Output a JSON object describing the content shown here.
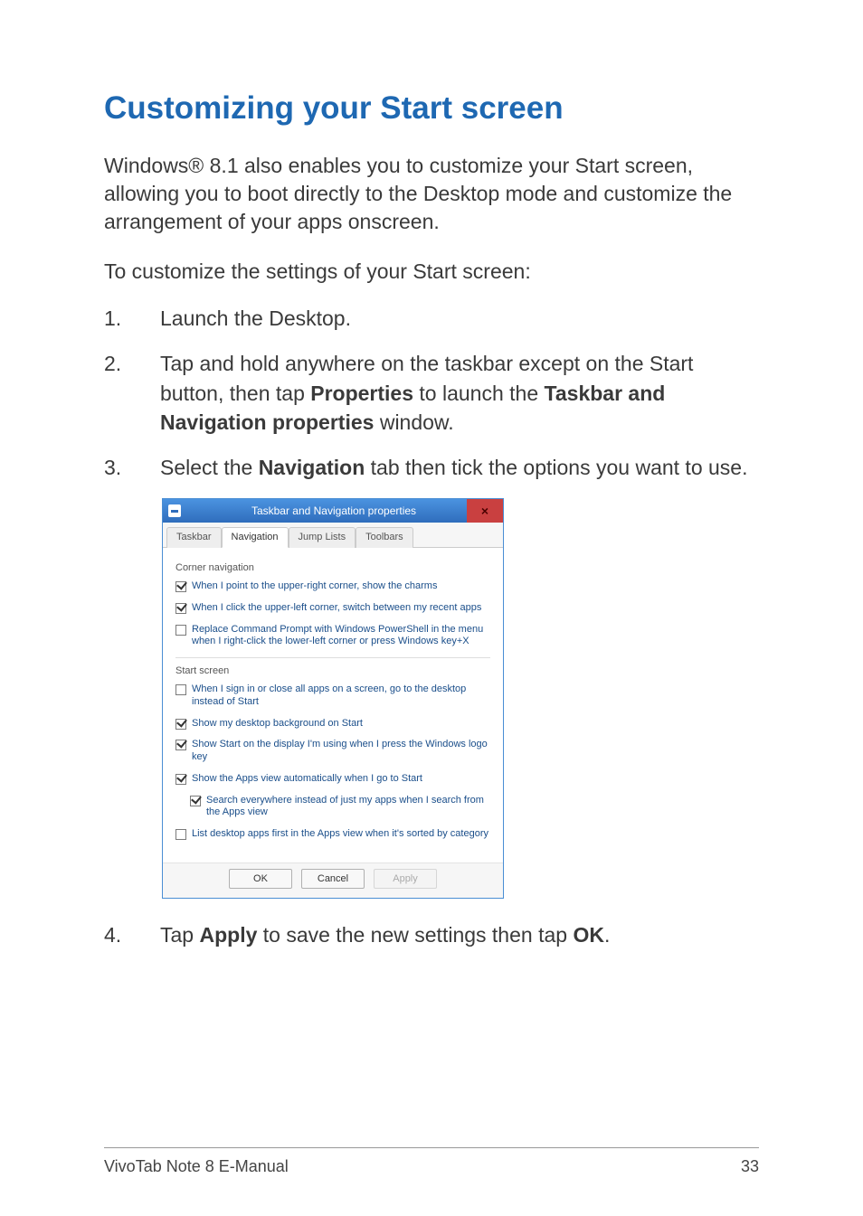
{
  "heading": "Customizing your Start screen",
  "intro": "Windows® 8.1 also enables you to customize your Start screen, allowing you to boot directly to the Desktop mode and customize the arrangement of your apps onscreen.",
  "instruction": "To customize the settings of your Start screen:",
  "steps": {
    "s1": {
      "num": "1.",
      "text": "Launch the Desktop."
    },
    "s2": {
      "num": "2.",
      "pre": "Tap and hold anywhere on the taskbar except on the Start button, then tap ",
      "b1": "Properties",
      "mid": " to launch the ",
      "b2": "Taskbar and Navigation properties",
      "post": " window."
    },
    "s3": {
      "num": "3.",
      "pre": "Select the ",
      "b1": "Navigation",
      "post": " tab then tick the options you want to use."
    },
    "s4": {
      "num": "4.",
      "pre": "Tap ",
      "b1": "Apply",
      "mid": " to save the new settings then tap ",
      "b2": "OK",
      "post": "."
    }
  },
  "dialog": {
    "title": "Taskbar and Navigation properties",
    "close": "×",
    "tabs": {
      "t1": "Taskbar",
      "t2": "Navigation",
      "t3": "Jump Lists",
      "t4": "Toolbars"
    },
    "group1": "Corner navigation",
    "opt1": "When I point to the upper-right corner, show the charms",
    "opt2": "When I click the upper-left corner, switch between my recent apps",
    "opt3": "Replace Command Prompt with Windows PowerShell in the menu when I right-click the lower-left corner or press Windows key+X",
    "group2": "Start screen",
    "opt4": "When I sign in or close all apps on a screen, go to the desktop instead of Start",
    "opt5": "Show my desktop background on Start",
    "opt6": "Show Start on the display I'm using when I press the Windows logo key",
    "opt7": "Show the Apps view automatically when I go to Start",
    "opt8": "Search everywhere instead of just my apps when I search from the Apps view",
    "opt9": "List desktop apps first in the Apps view when it's sorted by category",
    "buttons": {
      "ok": "OK",
      "cancel": "Cancel",
      "apply": "Apply"
    }
  },
  "footer": {
    "left": "VivoTab Note 8 E-Manual",
    "right": "33"
  }
}
